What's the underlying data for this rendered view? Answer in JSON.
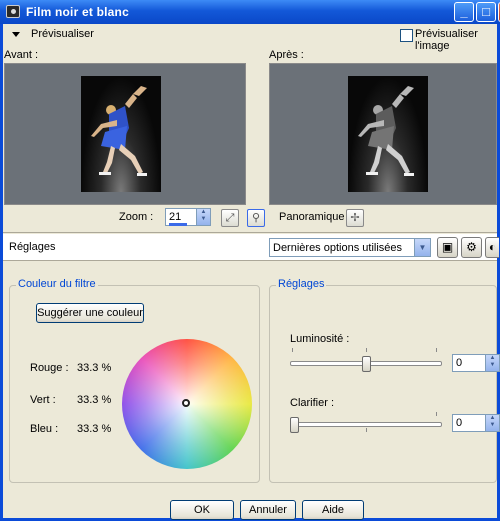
{
  "window": {
    "title": "Film noir et blanc",
    "minimize_glyph": "_",
    "maximize_glyph": "□",
    "close_glyph": "X"
  },
  "preview": {
    "toggle_label": "Prévisualiser",
    "preview_image_label": "Prévisualiser l'image",
    "preview_image_checked": false,
    "before_label": "Avant :",
    "after_label": "Après :",
    "zoom_label": "Zoom :",
    "zoom_value": "21",
    "pan_label": "Panoramique :"
  },
  "settings_bar": {
    "label": "Réglages",
    "preset_value": "Dernières options utilisées"
  },
  "filter_color": {
    "legend": "Couleur du filtre",
    "suggest_button": "Suggérer une couleur",
    "rows": [
      {
        "label": "Rouge :",
        "value": "33.3 %"
      },
      {
        "label": "Vert :",
        "value": "33.3 %"
      },
      {
        "label": "Bleu :",
        "value": "33.3 %"
      }
    ]
  },
  "adjustments": {
    "legend": "Réglages",
    "brightness": {
      "label": "Luminosité :",
      "value": "0",
      "level": 0.5
    },
    "clarify": {
      "label": "Clarifier :",
      "value": "0",
      "level": 0.0
    }
  },
  "footer": {
    "ok": "OK",
    "cancel": "Annuler",
    "help": "Aide"
  },
  "colors": {
    "title_bar": "#0a48c8",
    "group_legend": "#0046d5",
    "preview_bg": "#6b7178"
  }
}
